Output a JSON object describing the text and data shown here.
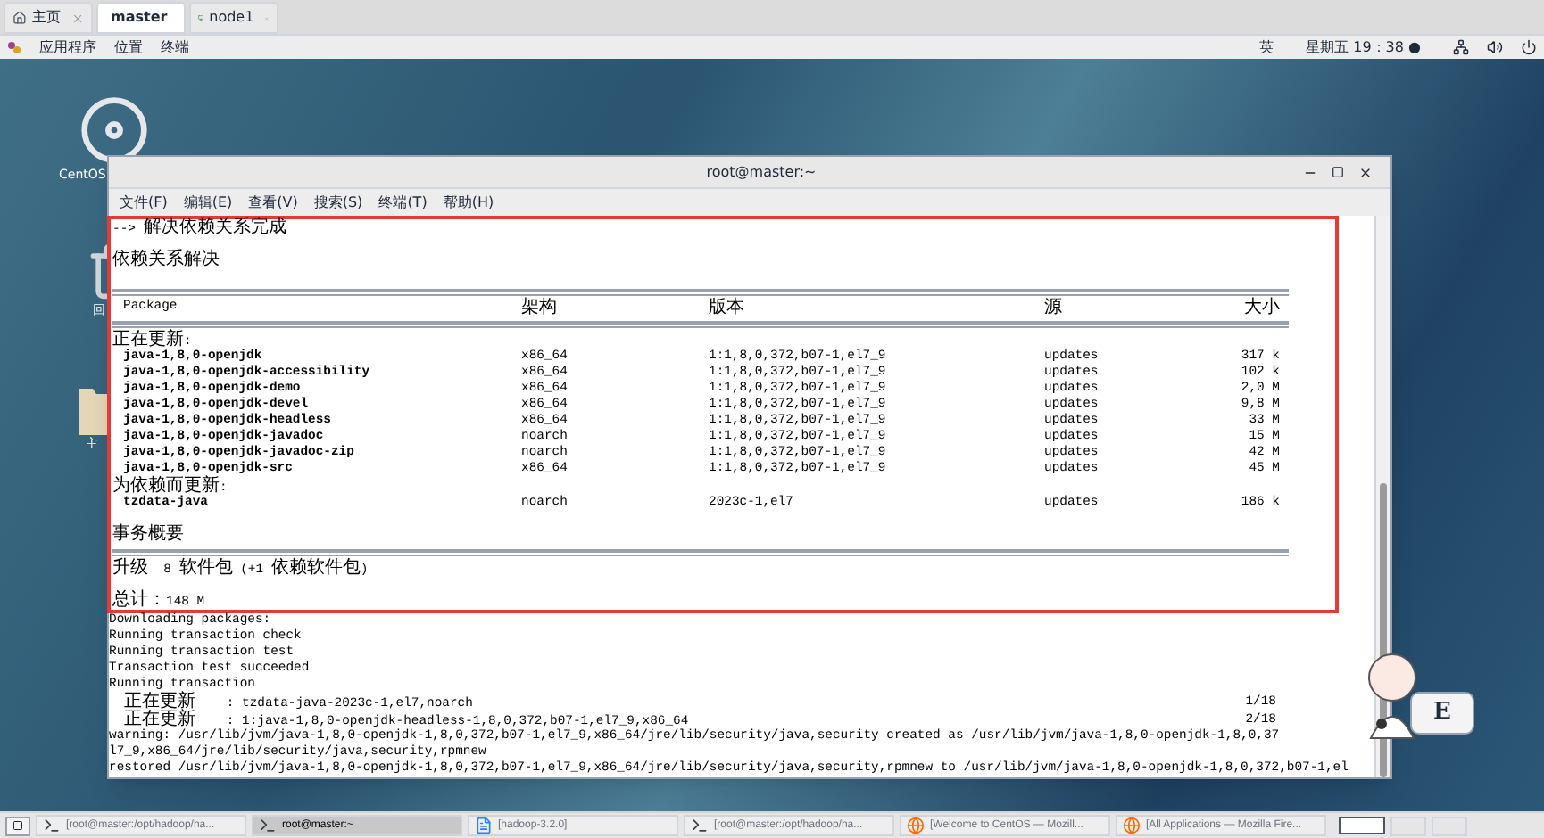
{
  "vm_tabs": [
    {
      "label": "主页",
      "kind": "home",
      "selected": false
    },
    {
      "label": "master",
      "kind": "vm",
      "selected": true
    },
    {
      "label": "node1",
      "kind": "vm",
      "selected": false
    }
  ],
  "panel": {
    "menus": [
      "应用程序",
      "位置",
      "终端"
    ],
    "input_method": "英",
    "clock": "星期五 19：38 ●"
  },
  "desktop_icons": [
    {
      "label": "CentOS",
      "kind": "disc"
    },
    {
      "label": "回",
      "kind": "trash"
    },
    {
      "label": "主",
      "kind": "folder"
    }
  ],
  "terminal": {
    "title": "root@master:~",
    "menu": [
      "文件(F)",
      "编辑(E)",
      "查看(V)",
      "搜索(S)",
      "终端(T)",
      "帮助(H)"
    ],
    "highlighted_lines": [
      {
        "kind": "text",
        "text": "--> 解决依赖关系完成"
      },
      {
        "kind": "blank"
      },
      {
        "kind": "text",
        "text": "依赖关系解决"
      },
      {
        "kind": "blank"
      },
      {
        "kind": "rule"
      },
      {
        "kind": "header",
        "cells": [
          "Package",
          "架构",
          "版本",
          "源",
          "大小"
        ]
      },
      {
        "kind": "rule"
      },
      {
        "kind": "text",
        "text": "正在更新:"
      },
      {
        "kind": "row",
        "cells": [
          "java-1,8,0-openjdk",
          "x86_64",
          "1:1,8,0,372,b07-1,el7_9",
          "updates",
          "317 k"
        ]
      },
      {
        "kind": "row",
        "cells": [
          "java-1,8,0-openjdk-accessibility",
          "x86_64",
          "1:1,8,0,372,b07-1,el7_9",
          "updates",
          "102 k"
        ]
      },
      {
        "kind": "row",
        "cells": [
          "java-1,8,0-openjdk-demo",
          "x86_64",
          "1:1,8,0,372,b07-1,el7_9",
          "updates",
          "2,0 M"
        ]
      },
      {
        "kind": "row",
        "cells": [
          "java-1,8,0-openjdk-devel",
          "x86_64",
          "1:1,8,0,372,b07-1,el7_9",
          "updates",
          "9,8 M"
        ]
      },
      {
        "kind": "row",
        "cells": [
          "java-1,8,0-openjdk-headless",
          "x86_64",
          "1:1,8,0,372,b07-1,el7_9",
          "updates",
          "33 M"
        ]
      },
      {
        "kind": "row",
        "cells": [
          "java-1,8,0-openjdk-javadoc",
          "noarch",
          "1:1,8,0,372,b07-1,el7_9",
          "updates",
          "15 M"
        ]
      },
      {
        "kind": "row",
        "cells": [
          "java-1,8,0-openjdk-javadoc-zip",
          "noarch",
          "1:1,8,0,372,b07-1,el7_9",
          "updates",
          "42 M"
        ]
      },
      {
        "kind": "row",
        "cells": [
          "java-1,8,0-openjdk-src",
          "x86_64",
          "1:1,8,0,372,b07-1,el7_9",
          "updates",
          "45 M"
        ]
      },
      {
        "kind": "text",
        "text": "为依赖而更新:"
      },
      {
        "kind": "row",
        "cells": [
          "tzdata-java",
          "noarch",
          "2023c-1,el7",
          "updates",
          "186 k"
        ]
      },
      {
        "kind": "blank"
      },
      {
        "kind": "text",
        "text": "事务概要"
      },
      {
        "kind": "rule"
      },
      {
        "kind": "text",
        "text": "升级  8 软件包 (+1 依赖软件包)"
      },
      {
        "kind": "blank"
      },
      {
        "kind": "text",
        "text": "总计：148 M"
      }
    ],
    "lines": [
      {
        "kind": "text",
        "text": "Downloading packages:"
      },
      {
        "kind": "text",
        "text": "Running transaction check"
      },
      {
        "kind": "text",
        "text": "Running transaction test"
      },
      {
        "kind": "text",
        "text": "Transaction test succeeded"
      },
      {
        "kind": "text",
        "text": "Running transaction"
      },
      {
        "kind": "progress",
        "text": "  正在更新    : tzdata-java-2023c-1,el7,noarch",
        "count": "1/18"
      },
      {
        "kind": "progress",
        "text": "  正在更新    : 1:java-1,8,0-openjdk-headless-1,8,0,372,b07-1,el7_9,x86_64",
        "count": "2/18"
      },
      {
        "kind": "text",
        "text": "warning: /usr/lib/jvm/java-1,8,0-openjdk-1,8,0,372,b07-1,el7_9,x86_64/jre/lib/security/java,security created as /usr/lib/jvm/java-1,8,0-openjdk-1,8,0,37"
      },
      {
        "kind": "text",
        "text": "l7_9,x86_64/jre/lib/security/java,security,rpmnew"
      },
      {
        "kind": "text",
        "text": "restored /usr/lib/jvm/java-1,8,0-openjdk-1,8,0,372,b07-1,el7_9,x86_64/jre/lib/security/java,security,rpmnew to /usr/lib/jvm/java-1,8,0-openjdk-1,8,0,372,b07-1,el"
      }
    ]
  },
  "ime_badge": {
    "label": "E"
  },
  "taskbar": {
    "items": [
      {
        "label": "[root@master:/opt/hadoop/ha...",
        "kind": "terminal",
        "selected": false
      },
      {
        "label": "root@master:~",
        "kind": "terminal",
        "selected": true
      },
      {
        "label": "[hadoop-3.2.0]",
        "kind": "file",
        "selected": false
      },
      {
        "label": "[root@master:/opt/hadoop/ha...",
        "kind": "terminal",
        "selected": false
      },
      {
        "label": "[Welcome to CentOS — Mozill...",
        "kind": "browser",
        "selected": false
      },
      {
        "label": "[All Applications — Mozilla Fire...",
        "kind": "browser",
        "selected": false
      }
    ]
  }
}
